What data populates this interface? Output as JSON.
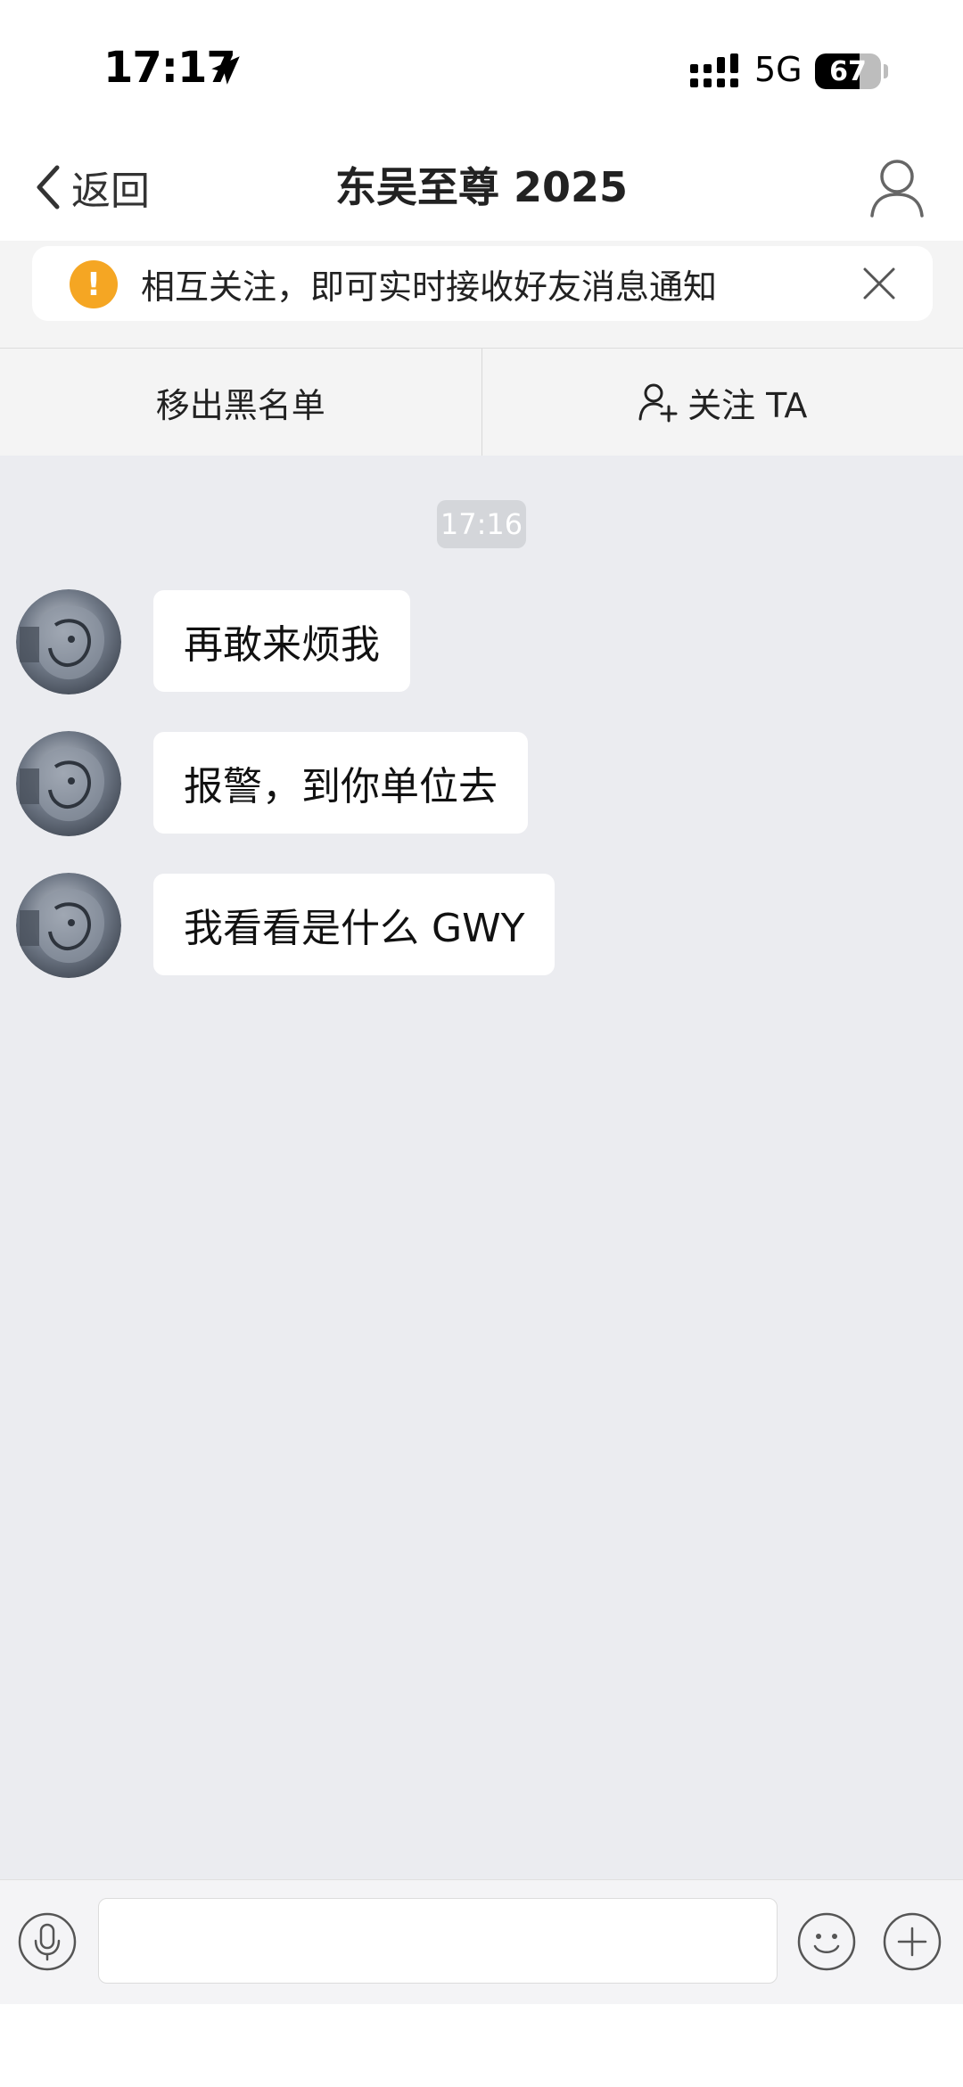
{
  "status_bar": {
    "time": "17:17",
    "network": "5G",
    "battery": "67",
    "battery_fraction": 0.67
  },
  "nav": {
    "back_label": "返回",
    "title": "东吴至尊 2025"
  },
  "notice": {
    "text": "相互关注，即可实时接收好友消息通知",
    "icon": "exclamation-icon"
  },
  "actions": {
    "remove_blacklist": "移出黑名单",
    "follow": "关注 TA"
  },
  "chat": {
    "timestamp": "17:16",
    "messages": [
      {
        "text": "再敢来烦我"
      },
      {
        "text": "报警，到你单位去"
      },
      {
        "text": "我看看是什么 GWY"
      }
    ]
  },
  "input": {
    "placeholder": ""
  },
  "colors": {
    "warning": "#f5a623",
    "chat_background": "#ebecf0",
    "bubble": "#ffffff"
  }
}
